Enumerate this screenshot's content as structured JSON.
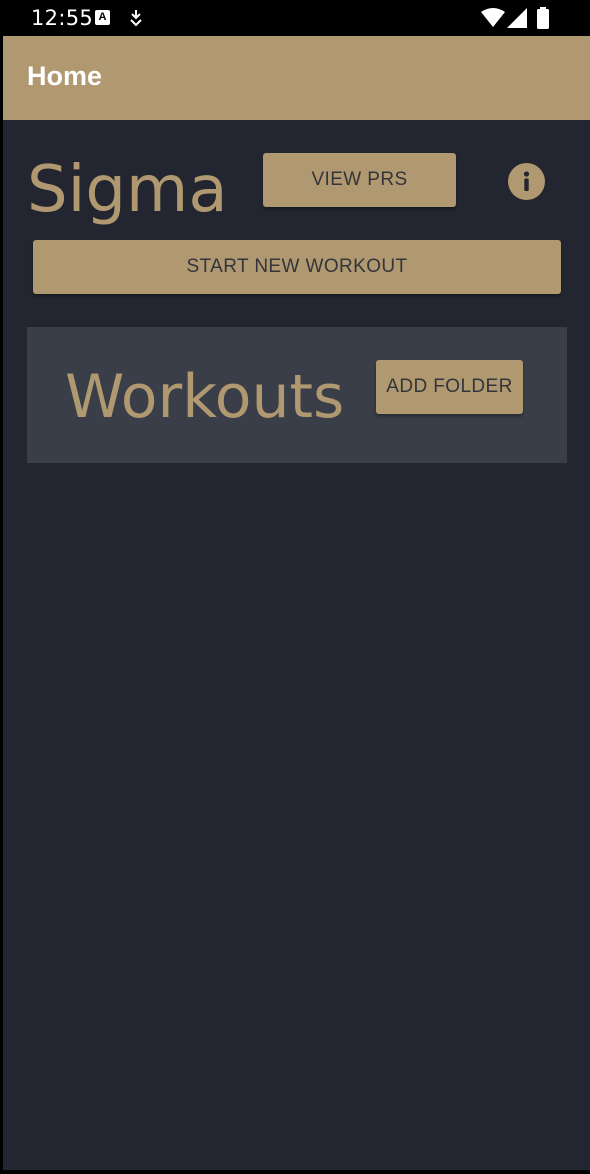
{
  "status_bar": {
    "time": "12:55",
    "icons": [
      "a-notification-icon",
      "download-icon",
      "wifi-icon",
      "signal-icon",
      "battery-icon"
    ]
  },
  "app_bar": {
    "title": "Home"
  },
  "main": {
    "title": "Sigma",
    "view_prs_label": "VIEW PRS",
    "info_icon": "info-icon",
    "start_workout_label": "START NEW WORKOUT"
  },
  "workouts": {
    "title": "Workouts",
    "add_folder_label": "ADD FOLDER"
  },
  "colors": {
    "accent": "#b09870",
    "background": "#232630",
    "card": "#3a3e48",
    "button_text": "#33353b"
  }
}
